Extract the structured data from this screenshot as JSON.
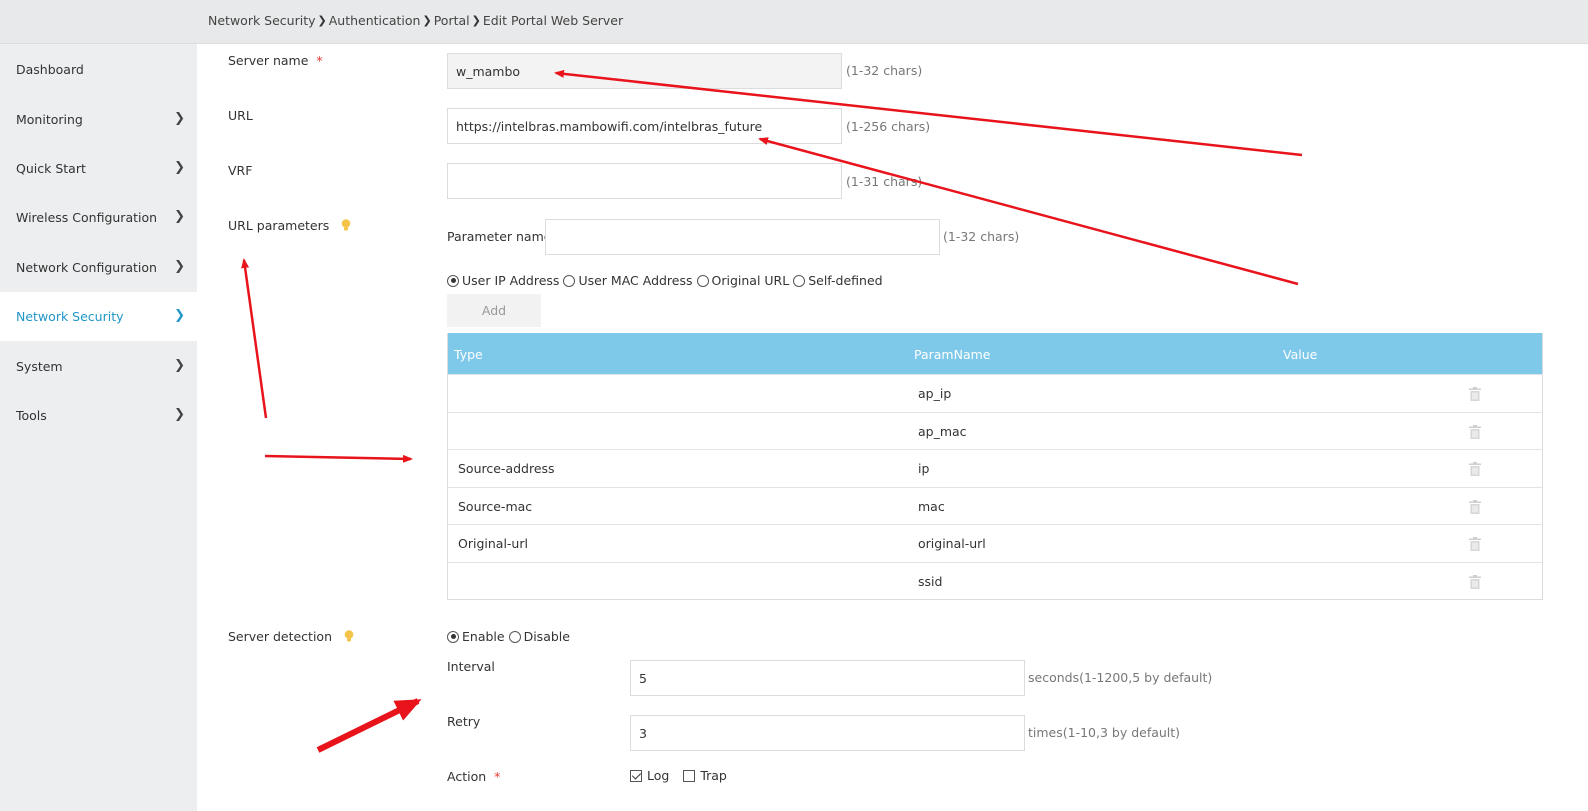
{
  "breadcrumb": [
    "Network Security",
    "Authentication",
    "Portal",
    "Edit Portal Web Server"
  ],
  "sidebar": {
    "items": [
      {
        "label": "Dashboard"
      },
      {
        "label": "Monitoring"
      },
      {
        "label": "Quick Start"
      },
      {
        "label": "Wireless Configuration"
      },
      {
        "label": "Network Configuration"
      },
      {
        "label": "Network Security",
        "active": true
      },
      {
        "label": "System"
      },
      {
        "label": "Tools"
      }
    ]
  },
  "form": {
    "server_name": {
      "label": "Server name",
      "required_mark": "*",
      "value": "w_mambo",
      "hint": "(1-32 chars)"
    },
    "url": {
      "label": "URL",
      "value": "https://intelbras.mambowifi.com/intelbras_future",
      "hint": "(1-256 chars)"
    },
    "vrf": {
      "label": "VRF",
      "value": "",
      "hint": "(1-31 chars)"
    },
    "url_parameters": {
      "label": "URL parameters",
      "param_name_label": "Parameter name",
      "param_name_value": "",
      "param_name_hint": "(1-32 chars)",
      "options": [
        "User IP Address",
        "User MAC Address",
        "Original URL",
        "Self-defined"
      ],
      "selected": "User IP Address",
      "add_label": "Add",
      "table": {
        "headers": [
          "Type",
          "ParamName",
          "Value"
        ],
        "rows": [
          {
            "type": "",
            "param": "ap_ip",
            "value": ""
          },
          {
            "type": "",
            "param": "ap_mac",
            "value": ""
          },
          {
            "type": "Source-address",
            "param": "ip",
            "value": ""
          },
          {
            "type": "Source-mac",
            "param": "mac",
            "value": ""
          },
          {
            "type": "Original-url",
            "param": "original-url",
            "value": ""
          },
          {
            "type": "",
            "param": "ssid",
            "value": ""
          }
        ]
      }
    },
    "server_detection": {
      "label": "Server detection",
      "options": [
        "Enable",
        "Disable"
      ],
      "selected": "Enable",
      "interval": {
        "label": "Interval",
        "value": "5",
        "hint": "seconds(1-1200,5 by default)"
      },
      "retry": {
        "label": "Retry",
        "value": "3",
        "hint": "times(1-10,3 by default)"
      },
      "action": {
        "label": "Action",
        "required_mark": "*",
        "log_label": "Log",
        "log_checked": true,
        "trap_label": "Trap",
        "trap_checked": false
      }
    }
  },
  "colors": {
    "accent": "#2196c8",
    "table_header": "#7ec8ea",
    "annotation": "#e8131b",
    "required": "#e53935"
  }
}
